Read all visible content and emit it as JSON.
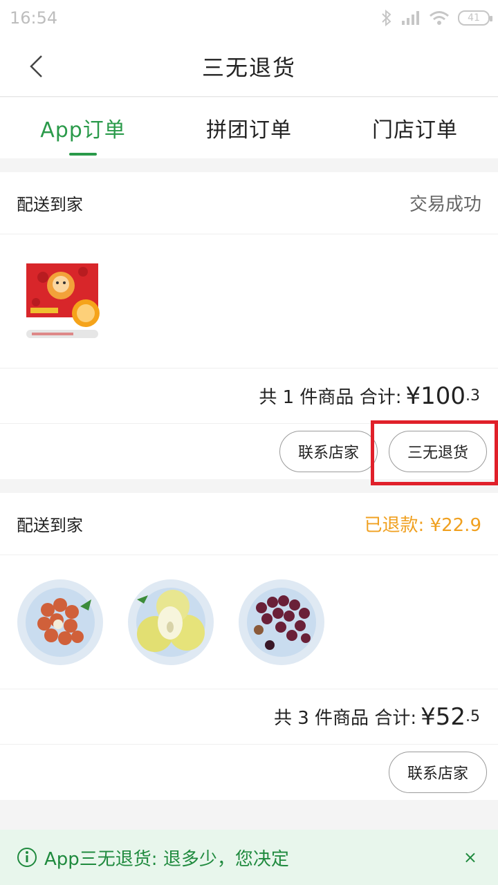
{
  "statusbar": {
    "time": "16:54",
    "battery": "41"
  },
  "navbar": {
    "title": "三无退货",
    "back_icon": "chevron-left-icon"
  },
  "tabs": [
    {
      "label": "App订单",
      "active": true
    },
    {
      "label": "拼团订单",
      "active": false
    },
    {
      "label": "门店订单",
      "active": false
    }
  ],
  "orders": [
    {
      "delivery": "配送到家",
      "status": "交易成功",
      "goods": [
        "orange-gift-box"
      ],
      "summary_prefix": "共 1 件商品 合计:",
      "price_int": "¥100",
      "price_dec": ".3",
      "buttons": [
        "联系店家",
        "三无退货"
      ]
    },
    {
      "delivery": "配送到家",
      "status": "已退款: ¥22.9",
      "goods": [
        "lychee-plate",
        "pear-plate",
        "grape-plate"
      ],
      "summary_prefix": "共 3 件商品 合计:",
      "price_int": "¥52",
      "price_dec": ".5",
      "buttons": [
        "联系店家"
      ]
    }
  ],
  "banner": {
    "text": "App三无退货: 退多少，您决定",
    "close": "×"
  },
  "colors": {
    "brand_green": "#2a9a4a",
    "refund_orange": "#f0a020",
    "highlight_red": "#e0202a"
  }
}
